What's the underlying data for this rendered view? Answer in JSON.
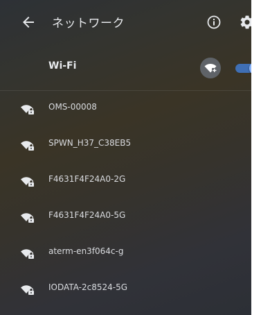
{
  "header": {
    "title": "ネットワーク",
    "back_icon": "arrow-left-icon",
    "info_icon": "info-icon",
    "settings_icon": "gear-icon"
  },
  "wifi": {
    "label": "Wi-Fi",
    "add_icon": "add-wifi-icon",
    "enabled": true
  },
  "networks": [
    {
      "name": "OMS-00008",
      "icon": "wifi-lock-icon"
    },
    {
      "name": "SPWN_H37_C38EB5",
      "icon": "wifi-lock-icon"
    },
    {
      "name": "F4631F4F24A0-2G",
      "icon": "wifi-lock-icon"
    },
    {
      "name": "F4631F4F24A0-5G",
      "icon": "wifi-lock-icon"
    },
    {
      "name": "aterm-en3f064c-g",
      "icon": "wifi-lock-icon"
    },
    {
      "name": "IODATA-2c8524-5G",
      "icon": "wifi-lock-icon"
    }
  ],
  "colors": {
    "background": "#33322f",
    "text": "#e8eaed",
    "toggle_track": "#3f6fb5",
    "toggle_knob": "#8ab4f8",
    "add_button": "#5f6368"
  }
}
